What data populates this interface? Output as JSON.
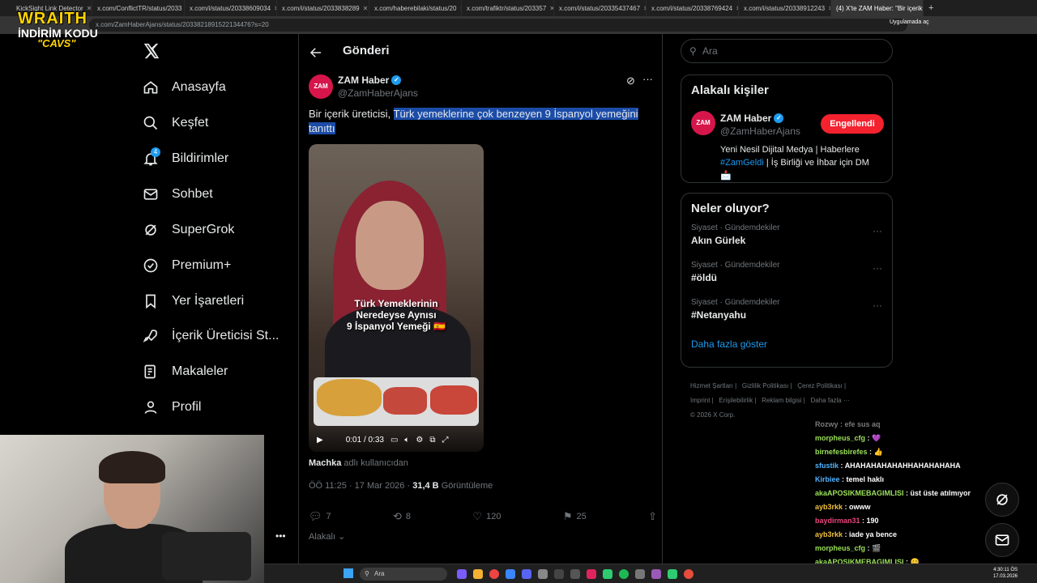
{
  "browser": {
    "tabs": [
      {
        "label": "KickSight Link Detector",
        "active": false
      },
      {
        "label": "x.com/ConflictTR/status/2033",
        "active": false
      },
      {
        "label": "x.com/i/status/20338609034",
        "active": false
      },
      {
        "label": "x.com/i/status/2033838289",
        "active": false
      },
      {
        "label": "x.com/haberebilaki/status/20",
        "active": false
      },
      {
        "label": "x.com/trafiktr/status/203357",
        "active": false
      },
      {
        "label": "x.com/i/status/20335437467",
        "active": false
      },
      {
        "label": "x.com/i/status/20338769424",
        "active": false
      },
      {
        "label": "x.com/i/status/20338912243",
        "active": false
      },
      {
        "label": "(4) X'te ZAM Haber: \"Bir içerik",
        "active": true
      }
    ],
    "url": "x.com/ZamHaberAjans/status/2033821891522134476?s=20",
    "app_badge": "Uygulamada aç"
  },
  "overlay": {
    "line1": "WRAITH",
    "line2": "İNDİRİM KODU",
    "line3": "\"CAVS\""
  },
  "nav": {
    "items": [
      {
        "label": "Anasayfa",
        "icon": "home-icon"
      },
      {
        "label": "Keşfet",
        "icon": "search-icon"
      },
      {
        "label": "Bildirimler",
        "icon": "bell-icon",
        "badge": "4"
      },
      {
        "label": "Sohbet",
        "icon": "mail-icon"
      },
      {
        "label": "SuperGrok",
        "icon": "grok-icon"
      },
      {
        "label": "Premium+",
        "icon": "premium-icon"
      },
      {
        "label": "Yer İşaretleri",
        "icon": "bookmark-icon"
      },
      {
        "label": "İçerik Üreticisi St...",
        "icon": "rocket-icon"
      },
      {
        "label": "Makaleler",
        "icon": "article-icon"
      },
      {
        "label": "Profil",
        "icon": "profile-icon"
      }
    ]
  },
  "post": {
    "header_title": "Gönderi",
    "avatar_text": "ZAM",
    "author": "ZAM Haber",
    "handle": "@ZamHaberAjans",
    "text_plain": "Bir içerik üreticisi, ",
    "text_highlight": "Türk yemeklerine çok benzeyen 9 İspanyol yemeğini tanıttı",
    "video_caption_1": "Türk Yemeklerinin",
    "video_caption_2": "Neredeyse Aynısı",
    "video_caption_3": "9 İspanyol Yemeği 🇪🇸",
    "video_time": "0:01 / 0:33",
    "attribution_user": "Machka",
    "attribution_suffix": "adlı kullanıcıdan",
    "timestamp": "ÖÖ 11:25 · 17 Mar 2026 · ",
    "views": "31,4 B",
    "views_label": "Görüntüleme",
    "replies": "7",
    "reposts": "8",
    "likes": "120",
    "bookmarks": "25",
    "related": "Alakalı"
  },
  "sidebar": {
    "search_placeholder": "Ara",
    "related_title": "Alakalı kişiler",
    "person_name": "ZAM Haber",
    "person_handle": "@ZamHaberAjans",
    "block_button": "Engellendi",
    "bio_1": "Yeni Nesil Dijital Medya | Haberlere ",
    "bio_tag": "#ZamGeldi",
    "bio_2": " | İş Birliği ve İhbar için DM 📩",
    "trends_title": "Neler oluyor?",
    "trends": [
      {
        "category": "Siyaset · Gündemdekiler",
        "name": "Akın Gürlek"
      },
      {
        "category": "Siyaset · Gündemdekiler",
        "name": "#öldü"
      },
      {
        "category": "Siyaset · Gündemdekiler",
        "name": "#Netanyahu"
      }
    ],
    "show_more": "Daha fazla göster",
    "footer_links": [
      "Hizmet Şartları",
      "Gizlilik Politikası",
      "Çerez Politikası",
      "Imprint",
      "Erişilebilirlik",
      "Reklam bilgisi",
      "Daha fazla ···"
    ],
    "copyright": "© 2026 X Corp."
  },
  "chat": [
    {
      "user": "Rozwy",
      "msg": "efe sus aq",
      "color": "#7a7a7a"
    },
    {
      "user": "morpheus_cfg",
      "msg": "💜",
      "color": "#9be05a"
    },
    {
      "user": "birnefesbirefes",
      "msg": "👍",
      "color": "#9be05a"
    },
    {
      "user": "sfustik",
      "msg": "AHAHAHAHAHAHHAHAHAHAHA",
      "color": "#4fb3ff"
    },
    {
      "user": "Kirbiee",
      "msg": "temel haklı",
      "color": "#4fb3ff"
    },
    {
      "user": "akaAPOSIKMEBAGIMLISI",
      "msg": "üst üste atılmıyor",
      "color": "#9be05a"
    },
    {
      "user": "ayb3rkk",
      "msg": "owww",
      "color": "#f0c040"
    },
    {
      "user": "baydirman31",
      "msg": "190",
      "color": "#e8457a"
    },
    {
      "user": "ayb3rkk",
      "msg": "iade ya bence",
      "color": "#f0c040"
    },
    {
      "user": "morpheus_cfg",
      "msg": "🎬",
      "color": "#9be05a"
    },
    {
      "user": "akaAPOSIKMEBAGIMLISI",
      "msg": "😊",
      "color": "#9be05a"
    }
  ],
  "taskbar": {
    "search_label": "Ara",
    "time": "4:30:11 ÖS",
    "date": "17.03.2026"
  },
  "colors": {
    "accent": "#1d9bf0",
    "block_button": "#f4212e",
    "highlight": "#1b4ca8"
  }
}
